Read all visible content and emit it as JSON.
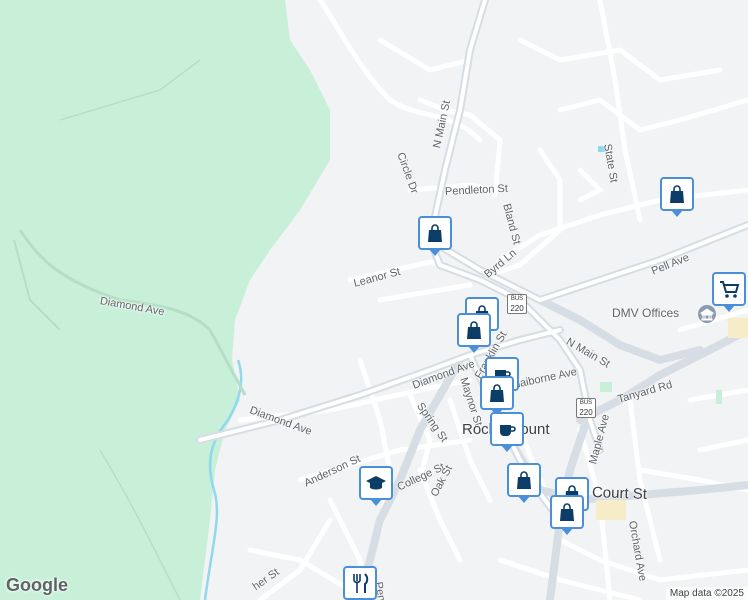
{
  "map": {
    "colors": {
      "park": "#c8f0d8",
      "land": "#f1f3f4",
      "road": "#ffffff",
      "major_road": "#d6dde4",
      "water": "#8fd8ee",
      "pin_border": "#4a90d9",
      "pin_icon": "#0b3d66"
    },
    "street_labels": {
      "n_main_st_north": "N Main St",
      "circle_dr": "Circle Dr",
      "state_st": "State St",
      "pendleton_st": "Pendleton St",
      "bland_st": "Bland St",
      "leanor_st": "Leanor St",
      "byrd_ln": "Byrd Ln",
      "pell_ave": "Pell Ave",
      "diamond_ave_west": "Diamond Ave",
      "diamond_ave_mid": "Diamond Ave",
      "diamond_ave_east": "Diamond Ave",
      "franklin_st": "Franklin St",
      "n_main_st_south": "N Main St",
      "maynor_st": "Maynor St",
      "spring_st": "Spring St",
      "claiborne_ave": "Claiborne Ave",
      "tanyard_rd": "Tanyard Rd",
      "maple_ave": "Maple Ave",
      "anderson_st": "Anderson St",
      "college_st": "College St",
      "oak_st": "Oak St",
      "court_st": "Court St",
      "orchard_ave": "Orchard Ave",
      "pent_st": "Pent St",
      "archer_st": "her St"
    },
    "place_label": "Rocky Mount",
    "poi_label": "DMV Offices",
    "route_shields": {
      "bus_220": "220",
      "us_220": "220",
      "bus_text": "BUS"
    },
    "pins": [
      {
        "icon": "shopping-bag-icon"
      },
      {
        "icon": "shopping-bag-icon"
      },
      {
        "icon": "shopping-bag-icon"
      },
      {
        "icon": "shopping-bag-icon"
      },
      {
        "icon": "coffee-cup-icon"
      },
      {
        "icon": "shopping-bag-icon"
      },
      {
        "icon": "shopping-bag-icon"
      },
      {
        "icon": "shopping-bag-icon"
      },
      {
        "icon": "shopping-cart-icon"
      },
      {
        "icon": "graduation-cap-icon"
      },
      {
        "icon": "fork-knife-icon"
      }
    ],
    "logo_text": "Google",
    "attribution": "Map data ©2025"
  }
}
